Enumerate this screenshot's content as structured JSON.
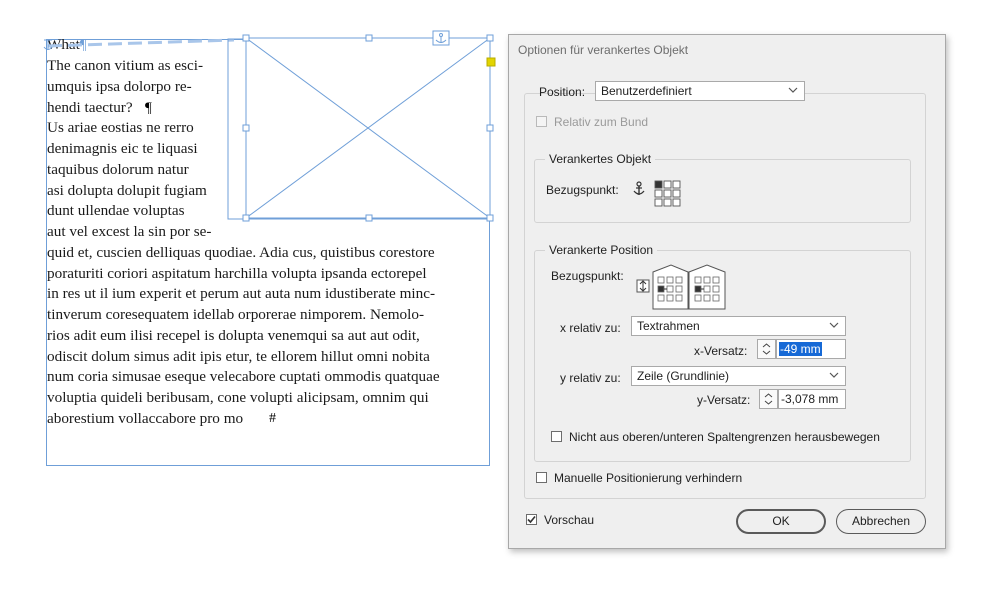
{
  "document": {
    "heading": "What",
    "lines_narrow": [
      "The canon vitium as esci-",
      "umquis ipsa dolorpo re-",
      "hendi taectur?",
      "Us ariae eostias ne rerro",
      "denimagnis eic te liquasi",
      "taquibus dolorum natur",
      "asi dolupta dolupit fugiam",
      "dunt ullendae voluptas",
      "aut vel excest la sin por se-"
    ],
    "lines_wide": [
      "quid et, cuscien delliquas quodiae. Adia cus, quistibus corestore",
      "poraturiti coriori aspitatum harchilla volupta ipsanda ectorepel",
      "in res ut il ium experit et perum aut auta num idustiberate minc-",
      "tinverum coresequatem idellab orporerae nimporem. Nemolo-",
      "rios adit eum ilisi recepel is dolupta venemqui sa aut aut odit,",
      "odiscit dolum simus adit ipis etur, te ellorem hillut omni nobita",
      "num coria simusae eseque velecabore cuptati ommodis quatquae",
      "voluptia quideli beribusam, cone volupti alicipsam, omnim qui",
      "aborestium vollaccabore pro mo"
    ],
    "pilcrow": "¶",
    "end_mark": "#",
    "frame_color": "#6f9fd8",
    "handle_color": "#e2d400"
  },
  "dialog": {
    "title": "Optionen für verankertes Objekt",
    "position_label": "Position:",
    "position_value": "Benutzerdefiniert",
    "relative_bund_label": "Relativ zum Bund",
    "anchored_object": {
      "title": "Verankertes Objekt",
      "ref_point_label": "Bezugspunkt:"
    },
    "anchored_position": {
      "title": "Verankerte Position",
      "ref_point_label": "Bezugspunkt:",
      "x_rel_label": "x relativ zu:",
      "x_rel_value": "Textrahmen",
      "x_offset_label": "x-Versatz:",
      "x_offset_value": "-49 mm",
      "y_rel_label": "y relativ zu:",
      "y_rel_value": "Zeile (Grundlinie)",
      "y_offset_label": "y-Versatz:",
      "y_offset_value": "-3,078 mm",
      "keep_within_label": "Nicht aus oberen/unteren Spaltengrenzen herausbewegen"
    },
    "prevent_manual_label": "Manuelle Positionierung verhindern",
    "preview_label": "Vorschau",
    "ok_label": "OK",
    "cancel_label": "Abbrechen",
    "selection_color": "#1669d6"
  }
}
